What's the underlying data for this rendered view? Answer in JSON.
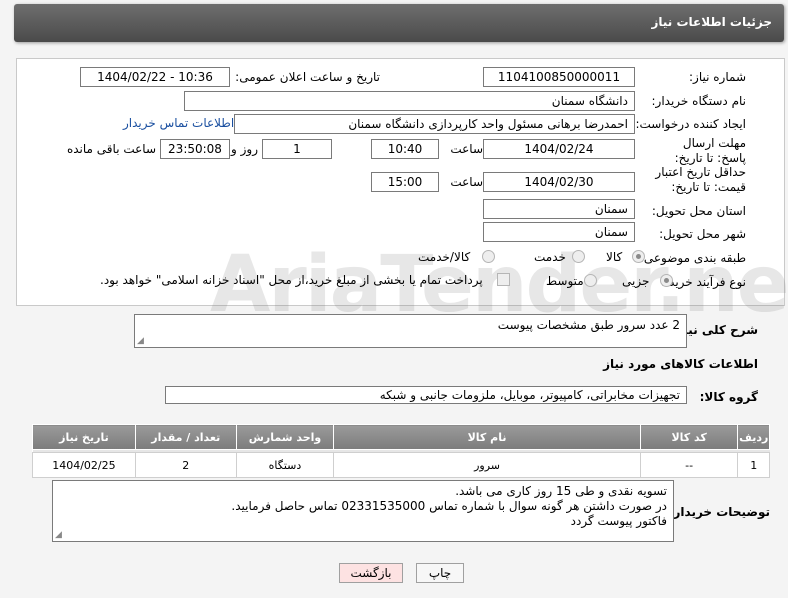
{
  "header": {
    "title": "جزئیات اطلاعات نیاز"
  },
  "form": {
    "need_number_label": "شماره نیاز:",
    "need_number": "1104100850000011",
    "announce_label": "تاریخ و ساعت اعلان عمومی:",
    "announce_value": "1404/02/22 - 10:36",
    "buyer_org_label": "نام دستگاه خریدار:",
    "buyer_org": "دانشگاه سمنان",
    "creator_label": "ایجاد کننده درخواست:",
    "creator": "احمدرضا برهانی مسئول واحد کارپردازی دانشگاه سمنان",
    "contact_link": "اطلاعات تماس خریدار",
    "deadline_label": "مهلت ارسال پاسخ: تا تاریخ:",
    "deadline_date": "1404/02/24",
    "time_label": "ساعت",
    "deadline_time": "10:40",
    "days_value": "1",
    "days_label": "روز و",
    "remaining_value": "23:50:08",
    "remaining_label": "ساعت باقی مانده",
    "validity_label": "حداقل تاریخ اعتبار قیمت: تا تاریخ:",
    "validity_date": "1404/02/30",
    "validity_time": "15:00",
    "province_label": "استان محل تحویل:",
    "province": "سمنان",
    "city_label": "شهر محل تحویل:",
    "city": "سمنان",
    "category_label": "طبقه بندی موضوعی:",
    "category_options": [
      "کالا",
      "خدمت",
      "کالا/خدمت"
    ],
    "process_label": "نوع فرآیند خرید :",
    "process_options": [
      "جزیی",
      "متوسط"
    ],
    "payment_note": "پرداخت تمام یا بخشی از مبلغ خرید،از محل \"اسناد خزانه اسلامی\" خواهد بود."
  },
  "watermark": "AriaTender.neT",
  "description": {
    "label": "شرح کلی نیاز:",
    "value": "2 عدد سرور طبق مشخصات پیوست"
  },
  "goods": {
    "section_title": "اطلاعات کالاهای مورد نیاز",
    "group_label": "گروه کالا:",
    "group_value": "تجهیزات مخابراتی، کامپیوتر، موبایل، ملزومات جانبی و شبکه",
    "columns": [
      "ردیف",
      "کد کالا",
      "نام کالا",
      "واحد شمارش",
      "تعداد / مقدار",
      "تاریخ نیاز"
    ],
    "rows": [
      [
        "1",
        "--",
        "سرور",
        "دستگاه",
        "2",
        "1404/02/25"
      ]
    ]
  },
  "buyer_notes": {
    "label": "توضیحات خریدار:",
    "line1": "تسویه نقدی و طی 15 روز کاری می باشد.",
    "line2": "در صورت داشتن هر گونه سوال با شماره تماس 02331535000 تماس حاصل فرمایید.",
    "line3": "فاکتور پیوست گردد"
  },
  "buttons": {
    "print": "چاپ",
    "back": "بازگشت"
  }
}
